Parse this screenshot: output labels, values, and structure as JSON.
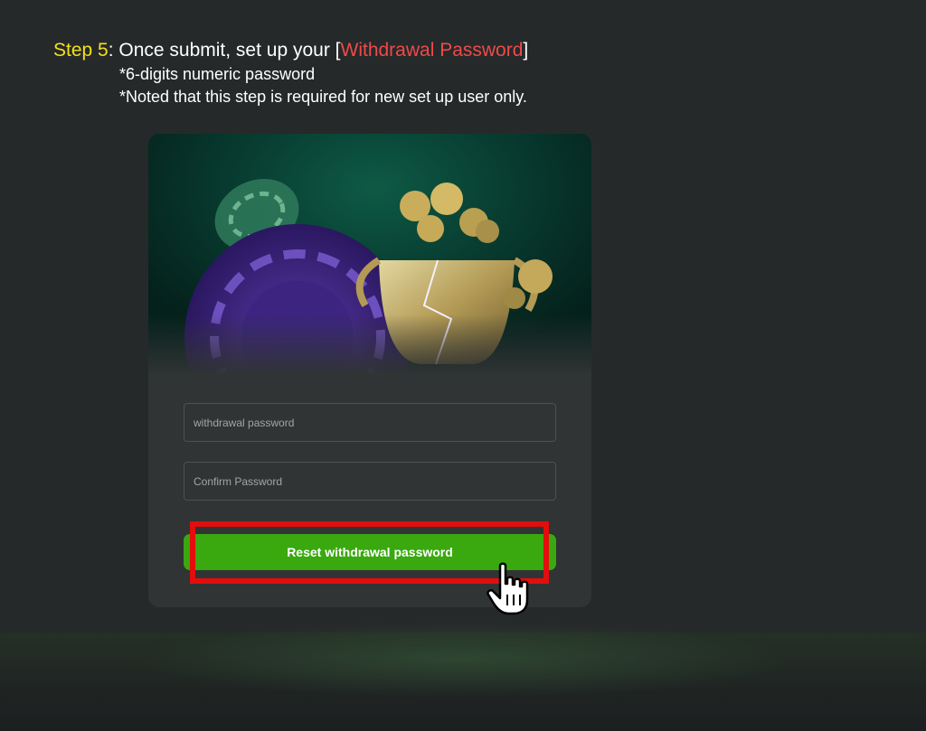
{
  "instructions": {
    "step_label": "Step 5",
    "step_text": ": Once submit, set up your [",
    "step_highlight": "Withdrawal Password",
    "step_close": "]",
    "note1": "*6-digits numeric password",
    "note2": "*Noted that this step is required for new set up user only."
  },
  "form": {
    "withdrawal_placeholder": "withdrawal password",
    "confirm_placeholder": "Confirm Password",
    "reset_label": "Reset withdrawal password"
  },
  "colors": {
    "step_label": "#f2e01d",
    "highlight_text": "#ee4a4a",
    "button": "#3aa80f",
    "annotation_box": "#e30d0d"
  },
  "icons": {
    "cursor": "hand-pointer-icon"
  }
}
